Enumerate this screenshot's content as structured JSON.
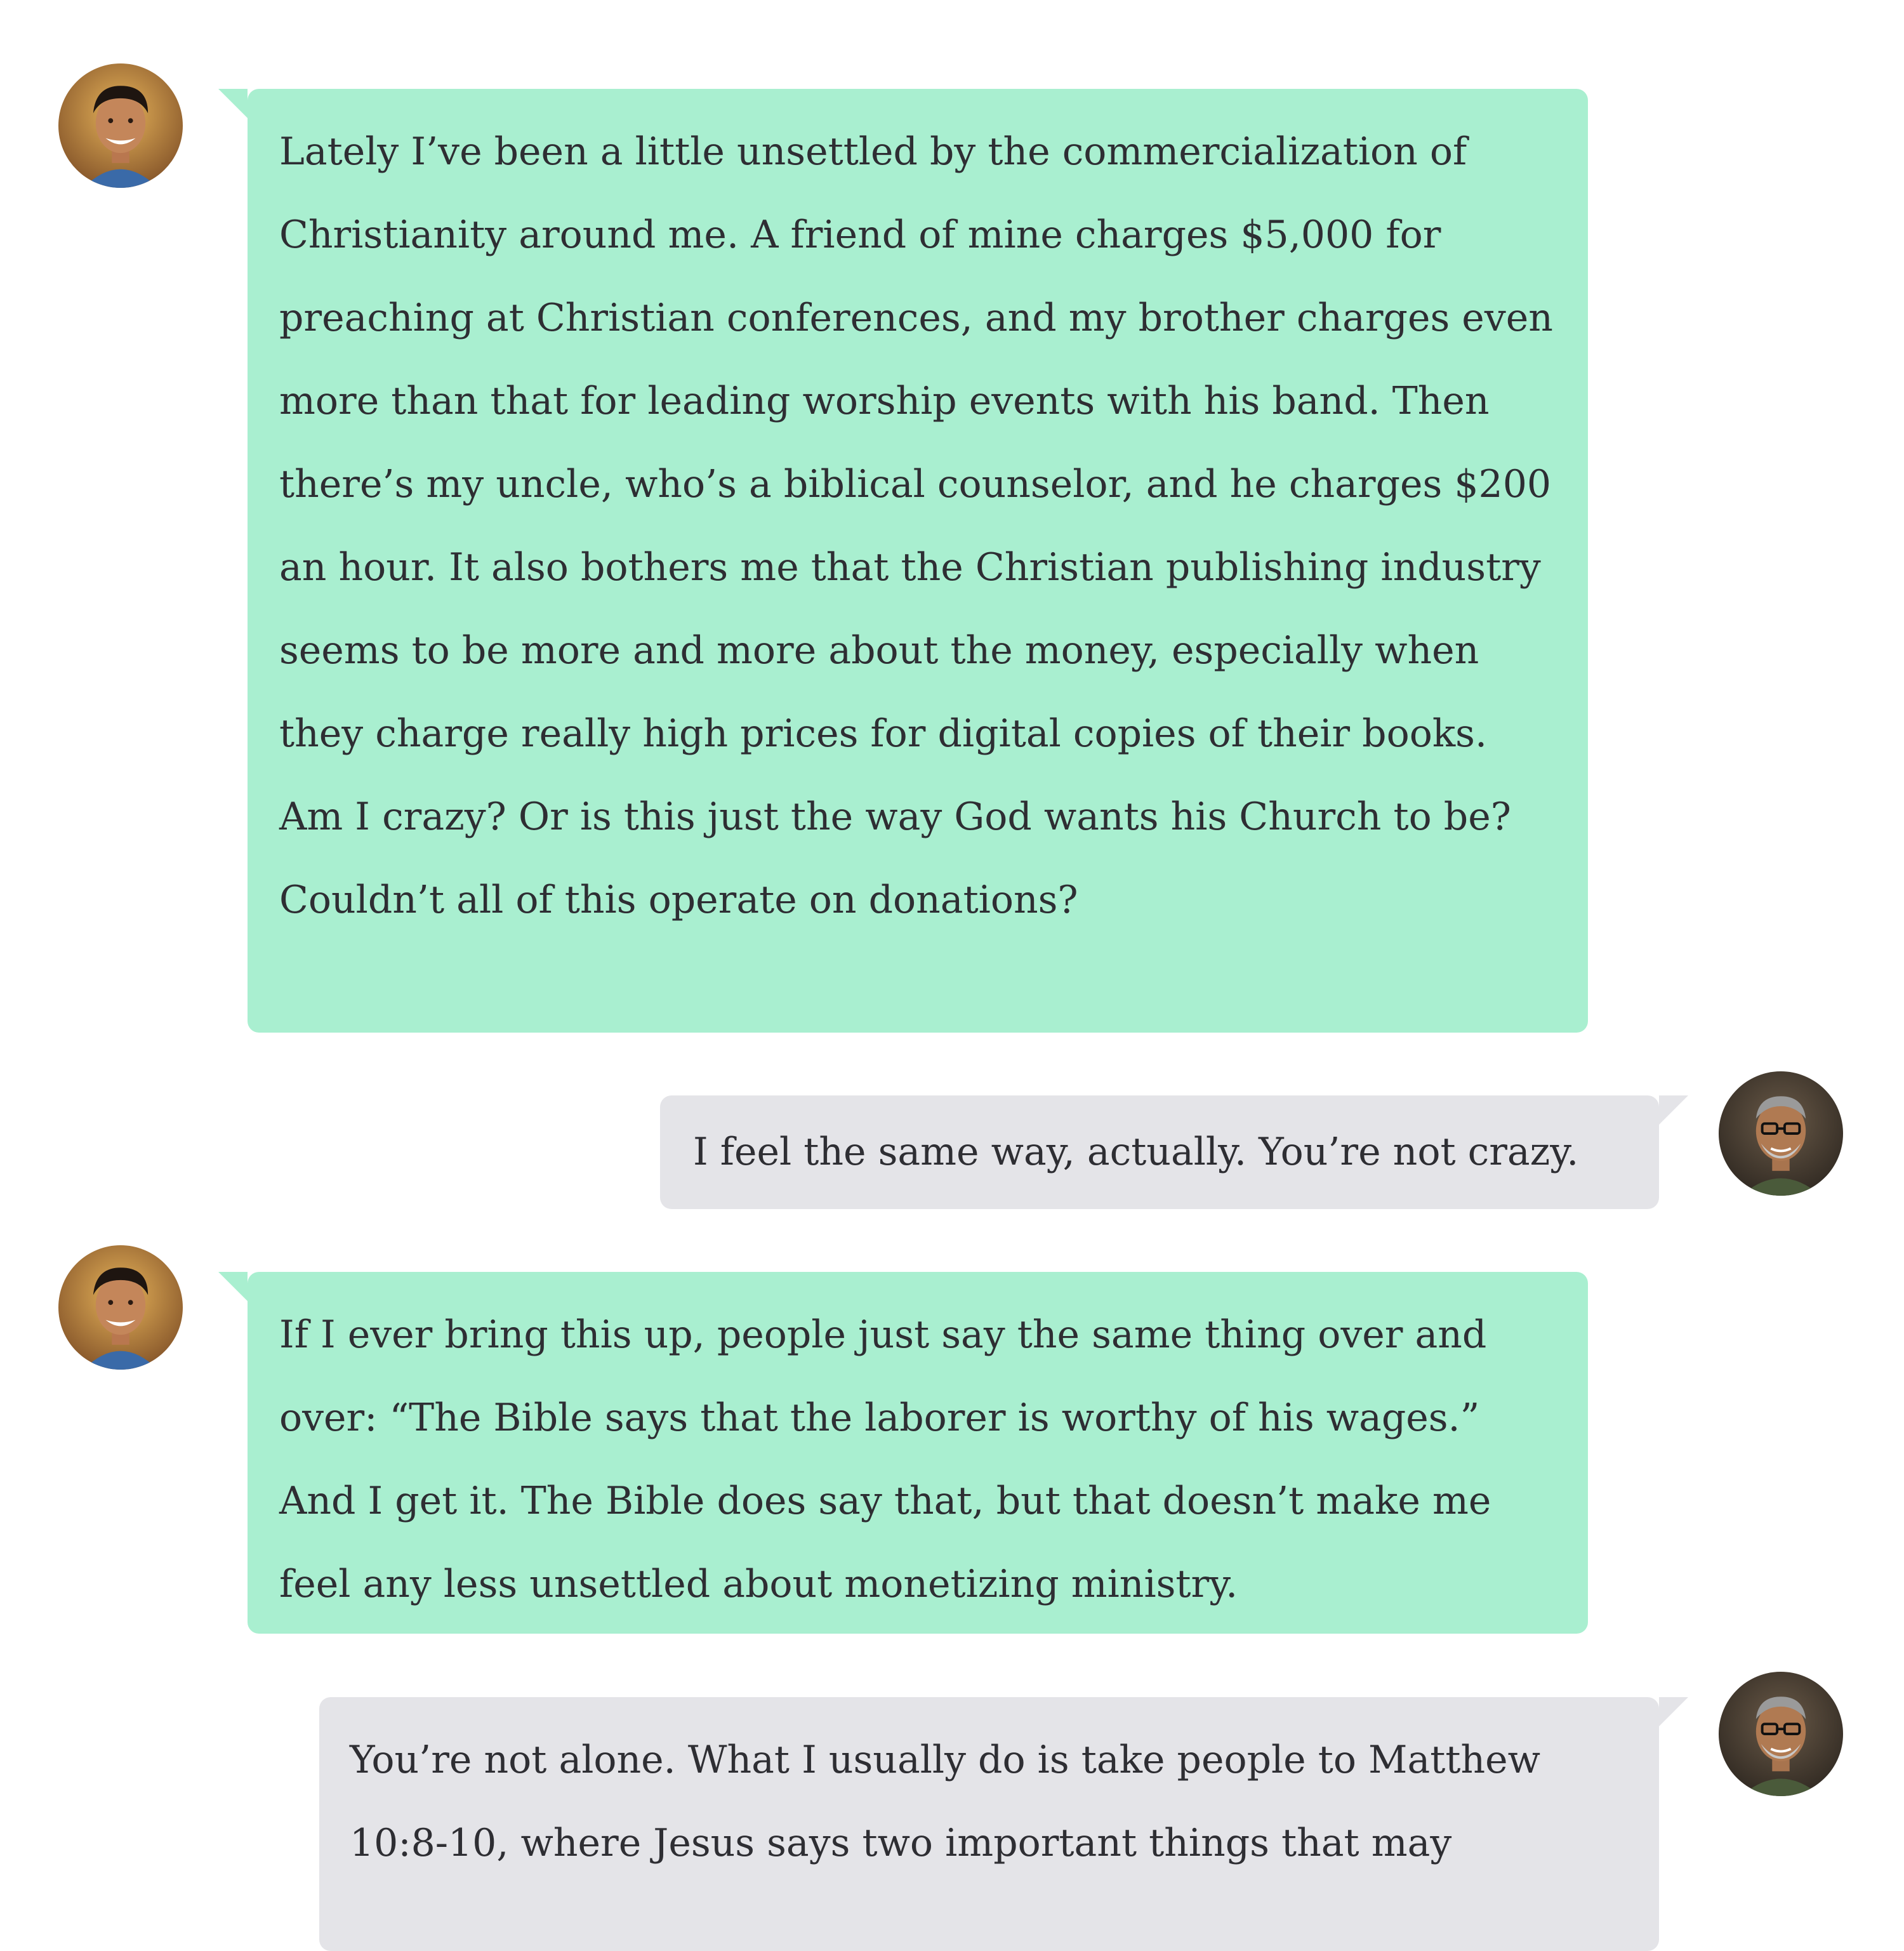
{
  "conversation": {
    "messages": [
      {
        "sender": "left",
        "text": "Lately I’ve been a little unsettled by the commercialization of Christianity around me. A friend of mine charges $5,000 for preaching at Christian conferences, and my brother charges even more than that for leading worship events with his band. Then there’s my uncle, who’s a biblical counselor, and he charges $200 an hour. It also bothers me that the Christian publishing industry seems to be more and more about the money, especially when they charge really high prices for digital copies of their books. Am I crazy? Or is this just the way God wants his Church to be? Couldn’t all of this operate on donations?"
      },
      {
        "sender": "right",
        "text": "I feel the same way, actually. You’re not crazy."
      },
      {
        "sender": "left",
        "text": "If I ever bring this up, people just say the same thing over and over: “The Bible says that the laborer is worthy of his wages.” And I get it. The Bible does say that, but that doesn’t make me feel any less unsettled about monetizing ministry."
      },
      {
        "sender": "right",
        "text": "You’re not alone. What I usually do is take people to Matthew 10:8-10, where Jesus says two important things that may"
      }
    ]
  },
  "colors": {
    "incoming_bubble": "#a9efd0",
    "outgoing_bubble": "#e4e4e8",
    "text": "#2e2e33"
  }
}
